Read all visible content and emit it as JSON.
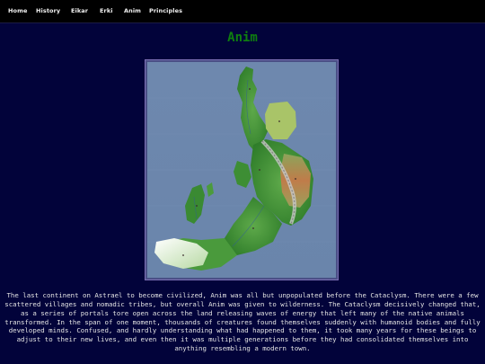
{
  "nav": {
    "items": [
      {
        "label": "Home"
      },
      {
        "label": "History"
      },
      {
        "label": "Eikar"
      },
      {
        "label": "Erki"
      },
      {
        "label": "Anim"
      },
      {
        "label": "Principles"
      }
    ]
  },
  "page": {
    "title": "Anim",
    "description": "The last continent on Astrael to become civilized, Anim was all but unpopulated before the Cataclysm. There were a few scattered villages and nomadic tribes, but overall Anim was given to wilderness. The Cataclysm decisively changed that, as a series of portals tore open across the land releasing waves of energy that left many of the native animals transformed. In the span of one moment, thousands of creatures found themselves suddenly with humanoid bodies and fully developed minds. Confused, and hardly understanding what had happened to them, it took many years for these beings to adjust to their new lives, and even then it was multiple generations before they had consolidated themselves into anything resembling a modern town."
  },
  "colors": {
    "background": "#02033a",
    "navbar": "#000000",
    "title": "#0f7f0f",
    "text": "#e4e4e4",
    "ocean": "#6b86ad",
    "frame_border": "#7d70b4"
  }
}
